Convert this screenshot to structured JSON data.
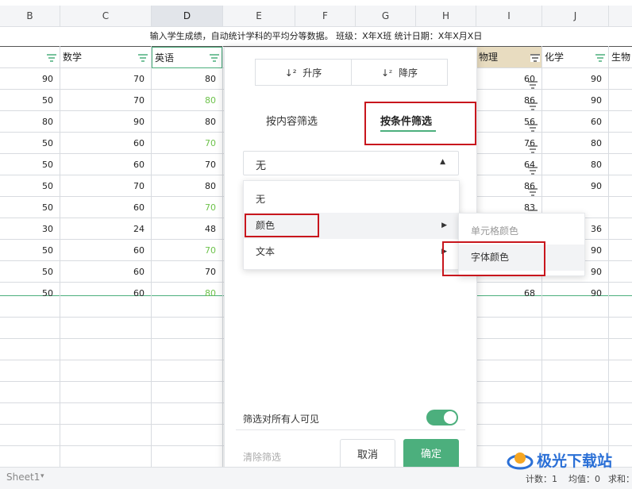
{
  "columns": [
    "B",
    "C",
    "D",
    "E",
    "F",
    "G",
    "H",
    "I",
    "J"
  ],
  "title_row": "输入学生成绩，自动统计学科的平均分等数据。 班级：X年X班 统计日期：X年X月X日",
  "headers": {
    "math": "数学",
    "english": "英语",
    "physics": "物理",
    "chemistry": "化学",
    "biology": "生物"
  },
  "rows": [
    {
      "b": "90",
      "c": "70",
      "d": "80",
      "d_green": false,
      "i": "60",
      "j": "90"
    },
    {
      "b": "50",
      "c": "70",
      "d": "80",
      "d_green": true,
      "i": "86",
      "j": "90"
    },
    {
      "b": "80",
      "c": "90",
      "d": "80",
      "d_green": false,
      "i": "56",
      "j": "60"
    },
    {
      "b": "50",
      "c": "60",
      "d": "70",
      "d_green": true,
      "i": "76",
      "j": "80"
    },
    {
      "b": "50",
      "c": "60",
      "d": "70",
      "d_green": false,
      "i": "64",
      "j": "80"
    },
    {
      "b": "50",
      "c": "70",
      "d": "80",
      "d_green": false,
      "i": "86",
      "j": "90"
    },
    {
      "b": "50",
      "c": "60",
      "d": "70",
      "d_green": true,
      "i": "83",
      "j": ""
    },
    {
      "b": "30",
      "c": "24",
      "d": "48",
      "d_green": false,
      "i": "",
      "j": "36"
    },
    {
      "b": "50",
      "c": "60",
      "d": "70",
      "d_green": true,
      "i": "",
      "j": "90"
    },
    {
      "b": "50",
      "c": "60",
      "d": "70",
      "d_green": false,
      "i": "",
      "j": "90"
    },
    {
      "b": "50",
      "c": "60",
      "d": "80",
      "d_green": true,
      "i": "68",
      "j": "90"
    }
  ],
  "panel": {
    "sort_asc": "升序",
    "sort_desc": "降序",
    "tab_content": "按内容筛选",
    "tab_condition": "按条件筛选",
    "dropdown_value": "无",
    "menu": {
      "none": "无",
      "color": "颜色",
      "text": "文本"
    },
    "submenu": {
      "cell_color": "单元格颜色",
      "font_color": "字体颜色"
    },
    "visible_label": "筛选对所有人可见",
    "clear": "清除筛选",
    "cancel": "取消",
    "confirm": "确定"
  },
  "toggle_on": true,
  "statusbar": {
    "sheet": "Sheet1",
    "count": "计数：1",
    "avg": "均值：0",
    "sum": "求和："
  },
  "watermark": "极光下载站",
  "colors": {
    "accent": "#4caf7d",
    "highlight_red": "#c8161d",
    "green_text": "#6dc24b"
  }
}
